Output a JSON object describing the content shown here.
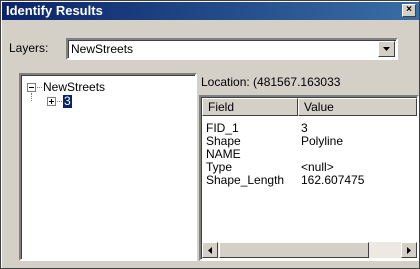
{
  "window": {
    "title": "Identify Results",
    "close_glyph": "×"
  },
  "layers": {
    "label": "Layers:",
    "selected": "NewStreets"
  },
  "tree": {
    "root": {
      "label": "NewStreets",
      "expander": "−"
    },
    "child": {
      "label": "3",
      "expander": "+"
    }
  },
  "details": {
    "location": "Location: (481567.163033",
    "columns": [
      "Field",
      "Value"
    ],
    "rows": [
      {
        "field": "FID_1",
        "value": "3"
      },
      {
        "field": "Shape",
        "value": "Polyline"
      },
      {
        "field": "NAME",
        "value": ""
      },
      {
        "field": "Type",
        "value": "<null>"
      },
      {
        "field": "Shape_Length",
        "value": "162.607475"
      }
    ]
  },
  "icons": {
    "close": "close-icon",
    "dropdown": "chevron-down-icon",
    "scroll_left": "arrow-left-icon",
    "scroll_right": "arrow-right-icon"
  }
}
